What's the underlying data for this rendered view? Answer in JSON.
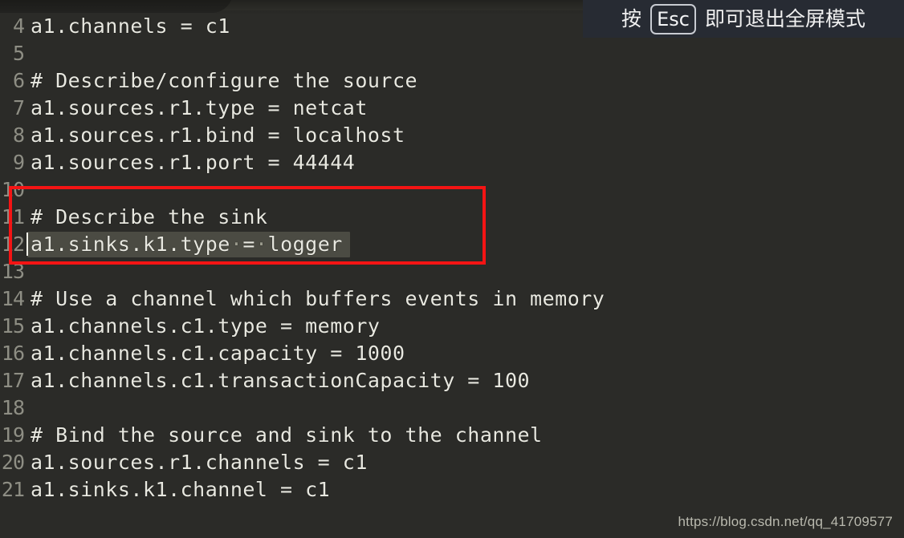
{
  "editor": {
    "file_kind": "flume-agent-config",
    "background_color": "#2b2b28",
    "text_color": "#e8e8e0",
    "gutter_color": "#8e8e84",
    "selection_color": "#4b4b43",
    "lines": [
      {
        "number": "4",
        "text": "a1.channels = c1"
      },
      {
        "number": "5",
        "text": ""
      },
      {
        "number": "6",
        "text": "# Describe/configure the source"
      },
      {
        "number": "7",
        "text": "a1.sources.r1.type = netcat"
      },
      {
        "number": "8",
        "text": "a1.sources.r1.bind = localhost"
      },
      {
        "number": "9",
        "text": "a1.sources.r1.port = 44444"
      },
      {
        "number": "10",
        "text": ""
      },
      {
        "number": "11",
        "text": "# Describe the sink"
      },
      {
        "number": "12",
        "text": "a1.sinks.k1.type = logger"
      },
      {
        "number": "13",
        "text": ""
      },
      {
        "number": "14",
        "text": "# Use a channel which buffers events in memory"
      },
      {
        "number": "15",
        "text": "a1.channels.c1.type = memory"
      },
      {
        "number": "16",
        "text": "a1.channels.c1.capacity = 1000"
      },
      {
        "number": "17",
        "text": "a1.channels.c1.transactionCapacity = 100"
      },
      {
        "number": "18",
        "text": ""
      },
      {
        "number": "19",
        "text": "# Bind the source and sink to the channel"
      },
      {
        "number": "20",
        "text": "a1.sources.r1.channels = c1"
      },
      {
        "number": "21",
        "text": "a1.sinks.k1.channel = c1"
      }
    ],
    "selected_line": {
      "number": "12",
      "prefix": "a1.sinks.k1.type",
      "ws1": "·",
      "equals": "=",
      "ws2": "·",
      "suffix": "logger"
    }
  },
  "annotation": {
    "shape": "rectangle",
    "color": "#f41414",
    "covers_lines": "11-12"
  },
  "fullscreen_hint": {
    "prefix": "按",
    "key": "Esc",
    "suffix": "即可退出全屏模式",
    "background_color": "#272b33"
  },
  "watermark": {
    "url": "https://blog.csdn.net/qq_41709577"
  }
}
